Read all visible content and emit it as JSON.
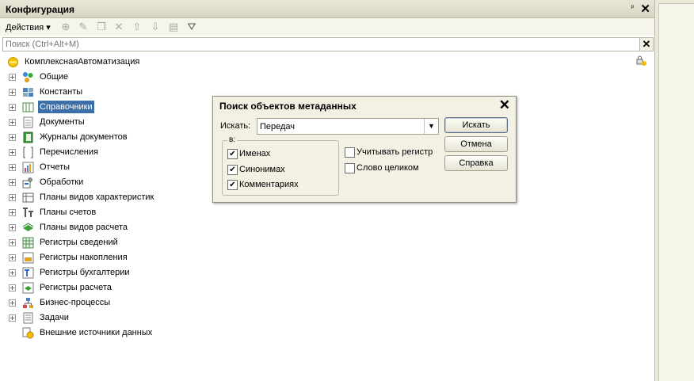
{
  "window": {
    "title": "Конфигурация",
    "pin_glyph": "ᵖ",
    "close_glyph": "✕"
  },
  "toolbar": {
    "actions_label": "Действия ▾"
  },
  "search": {
    "placeholder": "Поиск (Ctrl+Alt+M)",
    "clear_glyph": "✕"
  },
  "tree": {
    "root": "КомплекснаяАвтоматизация",
    "items": [
      {
        "label": "Общие",
        "icon": "common-icon"
      },
      {
        "label": "Константы",
        "icon": "constants-icon"
      },
      {
        "label": "Справочники",
        "icon": "catalogs-icon",
        "selected": true
      },
      {
        "label": "Документы",
        "icon": "documents-icon"
      },
      {
        "label": "Журналы документов",
        "icon": "document-journals-icon"
      },
      {
        "label": "Перечисления",
        "icon": "enums-icon"
      },
      {
        "label": "Отчеты",
        "icon": "reports-icon"
      },
      {
        "label": "Обработки",
        "icon": "data-processors-icon"
      },
      {
        "label": "Планы видов характеристик",
        "icon": "chart-of-characteristic-types-icon"
      },
      {
        "label": "Планы счетов",
        "icon": "chart-of-accounts-icon"
      },
      {
        "label": "Планы видов расчета",
        "icon": "chart-of-calculation-types-icon"
      },
      {
        "label": "Регистры сведений",
        "icon": "information-registers-icon"
      },
      {
        "label": "Регистры накопления",
        "icon": "accumulation-registers-icon"
      },
      {
        "label": "Регистры бухгалтерии",
        "icon": "accounting-registers-icon"
      },
      {
        "label": "Регистры расчета",
        "icon": "calculation-registers-icon"
      },
      {
        "label": "Бизнес-процессы",
        "icon": "business-processes-icon"
      },
      {
        "label": "Задачи",
        "icon": "tasks-icon"
      },
      {
        "label": "Внешние источники данных",
        "icon": "external-data-sources-icon"
      }
    ]
  },
  "dialog": {
    "title": "Поиск объектов метаданных",
    "close_glyph": "✕",
    "search_label": "Искать:",
    "search_value": "Передач",
    "group_caption": "в:",
    "checks": {
      "names": {
        "label": "Именах",
        "checked": true
      },
      "synonyms": {
        "label": "Синонимах",
        "checked": true
      },
      "comments": {
        "label": "Комментариях",
        "checked": true
      },
      "match_case": {
        "label": "Учитывать регистр",
        "checked": false
      },
      "whole_word": {
        "label": "Слово целиком",
        "checked": false
      }
    },
    "buttons": {
      "find": "Искать",
      "cancel": "Отмена",
      "help": "Справка"
    }
  },
  "colors": {
    "selection": "#3c6ea8",
    "panel": "#f2f1e3"
  }
}
